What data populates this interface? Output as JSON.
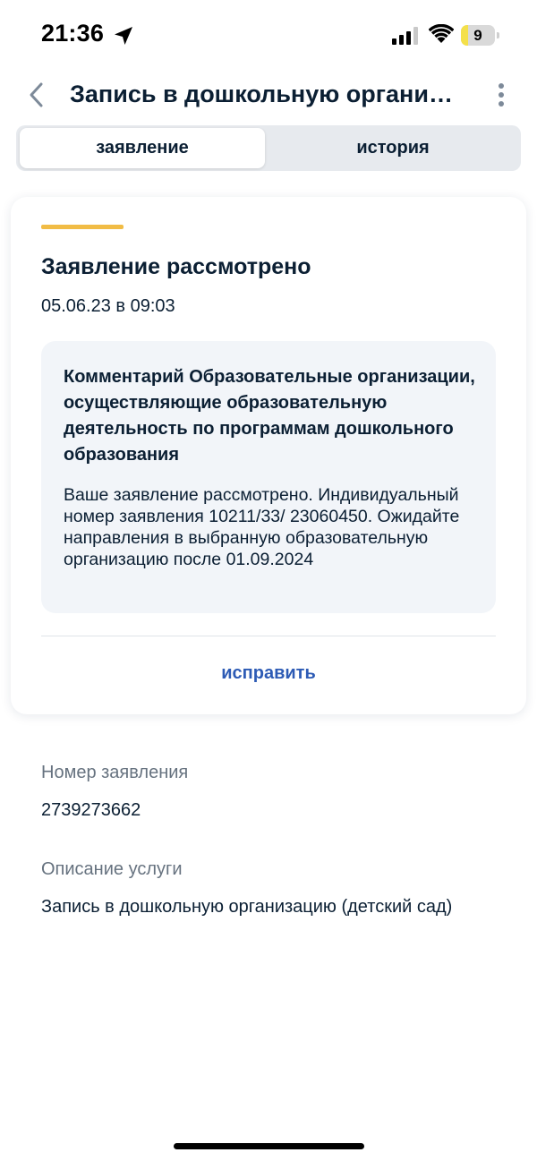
{
  "status_bar": {
    "time": "21:36",
    "battery_level": "9",
    "battery_fraction": 0.09,
    "icons": [
      "location-arrow-icon",
      "cellular-signal-icon",
      "wifi-icon",
      "battery-icon"
    ]
  },
  "header": {
    "title": "Запись в дошкольную организацию (детский сад)",
    "back_icon": "chevron-left-icon",
    "more_icon": "more-vertical-icon"
  },
  "tabs": [
    {
      "label": "заявление",
      "active": true
    },
    {
      "label": "история",
      "active": false
    }
  ],
  "card": {
    "title": "Заявление рассмотрено",
    "date": "05.06.23 в 09:03",
    "comment_title": "Комментарий Образовательные организации, осуществляющие образовательную деятельность по программам дошкольного образования",
    "comment_text": "Ваше заявление рассмотрено. Индивидуальный номер заявления 10211/33/ 23060450. Ожидайте направления в выбранную образовательную организацию после 01.09.2024",
    "action_label": "исправить",
    "accent_color": "#f1bc45",
    "action_color": "#2d5bb5"
  },
  "details": {
    "number_label": "Номер заявления",
    "number_value": "2739273662",
    "description_label": "Описание услуги",
    "description_value": "Запись в дошкольную организацию (детский сад)"
  }
}
